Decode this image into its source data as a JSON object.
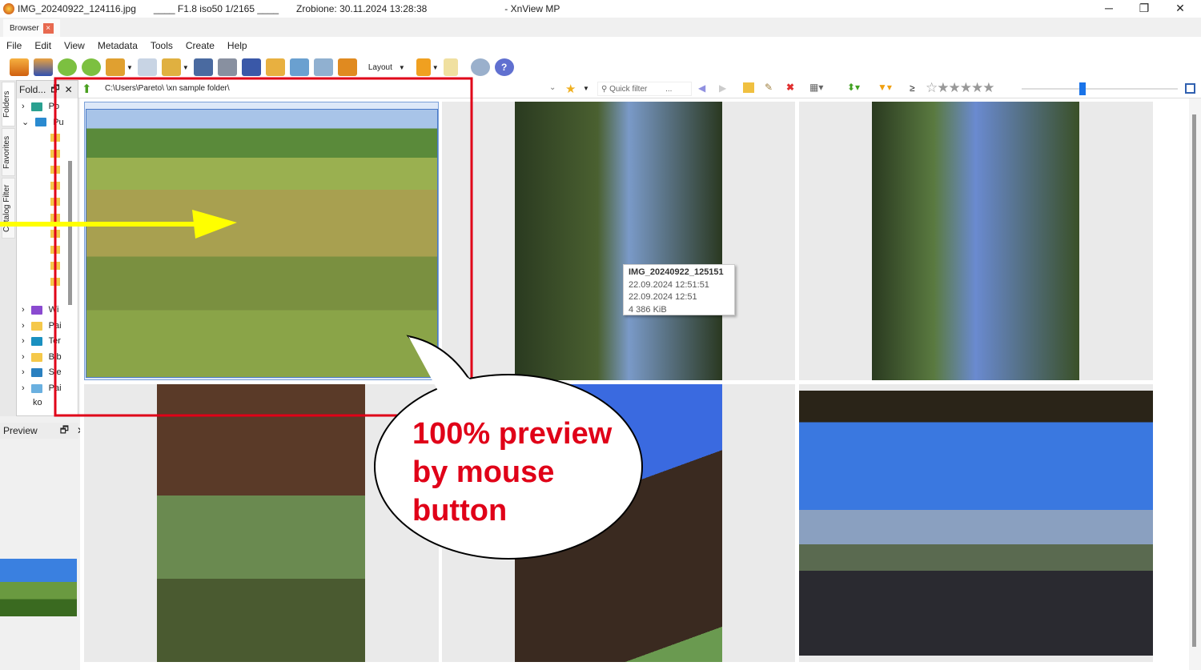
{
  "titlebar": {
    "filename": "IMG_20240922_124116.jpg",
    "exif": "____ F1.8  iso50  1/2165 ____",
    "taken": "Zrobione: 30.11.2024 13:28:38",
    "app": "- XnView MP",
    "min": "─",
    "max": "❐",
    "close": "✕"
  },
  "tabs": [
    {
      "label": "Browser",
      "close": "×"
    }
  ],
  "menu": [
    "File",
    "Edit",
    "View",
    "Metadata",
    "Tools",
    "Create",
    "Help"
  ],
  "toolbar": {
    "layout_label": "Layout"
  },
  "sidetabs": [
    "Folders",
    "Favorites",
    "Catalog Filter"
  ],
  "folders": {
    "title": "Fold...",
    "items": [
      "Po",
      "Pu",
      "Wi",
      "Pai",
      "Ter",
      "Bib",
      "Sie",
      "Pai",
      "ko"
    ]
  },
  "preview": {
    "title": "Preview"
  },
  "pathbar": {
    "path": "C:\\Users\\Pareto\\        \\xn sample folder\\",
    "quick_filter_placeholder": "Quick filter",
    "more": "...",
    "ge": "≥"
  },
  "tooltip": {
    "name": "IMG_20240922_125151",
    "date1": "22.09.2024 12:51:51",
    "date2": "22.09.2024 12:51",
    "size": "4 386 KiB"
  },
  "callout": {
    "line1": "100% preview",
    "line2": "by mouse",
    "line3": "button"
  },
  "colors": {
    "annotation_red": "#e00018",
    "arrow_yellow": "#ffff00",
    "accent": "#1a73e8"
  }
}
